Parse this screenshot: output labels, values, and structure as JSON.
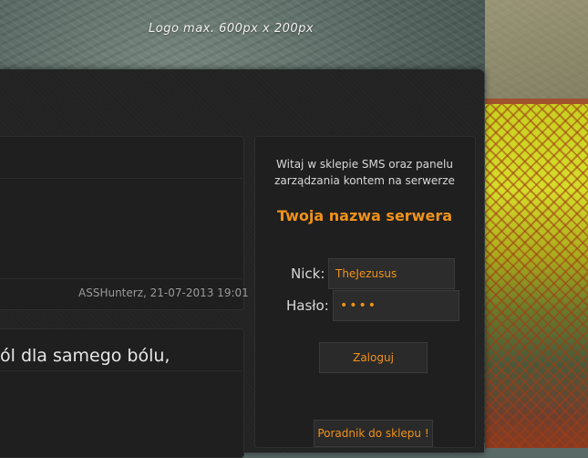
{
  "header": {
    "logo_note": "Logo max. 600px x 200px"
  },
  "posts": [
    {
      "meta": "ASSHunterz, 21-07-2013 19:01"
    },
    {
      "title": "ól dla samego bólu,"
    }
  ],
  "login": {
    "welcome_text": "Witaj w sklepie SMS oraz panelu zarządzania kontem na serwerze",
    "server_name": "Twoja nazwa serwera",
    "nick_label": "Nick:",
    "nick_value": "TheJezusus",
    "password_label": "Hasło:",
    "password_value": "••••",
    "login_button": "Zaloguj",
    "guide_button": "Poradnik do sklepu !"
  },
  "colors": {
    "accent": "#f0921a",
    "panel": "#232323"
  }
}
